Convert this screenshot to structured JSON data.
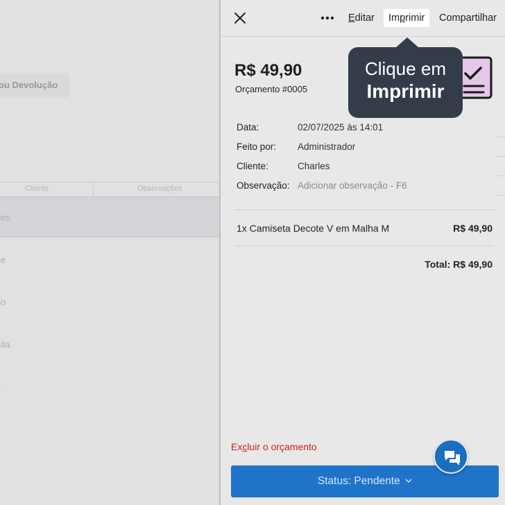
{
  "background": {
    "return_button": "ou Devolução",
    "table": {
      "headers": [
        "Cliente",
        "Observações"
      ],
      "rows": [
        "rles",
        "ne",
        "go",
        "nila",
        "e"
      ]
    }
  },
  "panel": {
    "header": {
      "close_icon": "close-icon",
      "more_icon": "more-horizontal-icon",
      "edit": {
        "pre": "",
        "underlined": "E",
        "post": "ditar"
      },
      "print": {
        "pre": "Im",
        "underlined": "p",
        "post": "rimir"
      },
      "share": "Compartilhar"
    },
    "amount": "R$ 49,90",
    "quote_number": "Orçamento #0005",
    "doc_icon": "document-check-icon",
    "info": [
      {
        "label": "Data:",
        "value": "02/07/2025 às 14:01"
      },
      {
        "label": "Feito por:",
        "value": "Administrador"
      },
      {
        "label": "Cliente:",
        "value": "Charles"
      },
      {
        "label": "Observação:",
        "value": "Adicionar observação - F6"
      }
    ],
    "item": {
      "description": "1x Camiseta Decote V em Malha M",
      "price": "R$ 49,90"
    },
    "total": "Total: R$ 49,90",
    "delete": {
      "pre": "Ex",
      "underlined": "c",
      "post": "luir o orçamento"
    },
    "status_button": "Status: Pendente",
    "chat_icon": "chat-icon"
  },
  "tooltip": {
    "line1": "Clique em",
    "line2": "Imprimir"
  },
  "colors": {
    "accent": "#1f74c9",
    "danger": "#cc1f1f",
    "tooltip_bg": "#343c4a",
    "doc_icon_fill": "#e3c8e8"
  }
}
